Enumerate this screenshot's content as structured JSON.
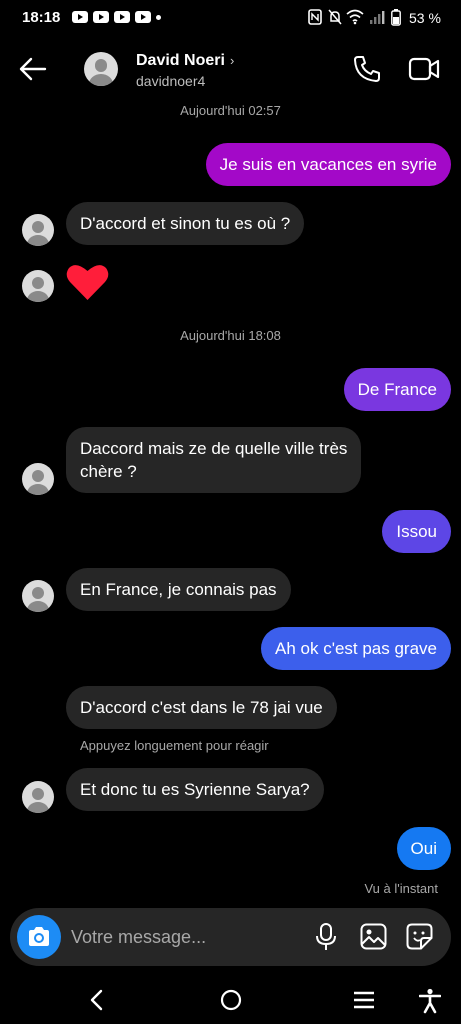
{
  "status_bar": {
    "time": "18:18",
    "battery": "53 %",
    "icons": [
      "youtube-icon",
      "youtube-icon",
      "youtube-icon",
      "youtube-icon",
      "notification-dot",
      "nfc-icon",
      "mute-icon",
      "wifi-icon",
      "signal-icon",
      "battery-icon"
    ]
  },
  "header": {
    "name": "David Noeri",
    "chevron": "›",
    "username": "davidnoer4"
  },
  "timestamps": {
    "first": "Aujourd'hui 02:57",
    "second": "Aujourd'hui 18:08"
  },
  "messages": [
    {
      "from": "me",
      "text": "Je suis en vacances en syrie",
      "color": "#a309c8"
    },
    {
      "from": "them",
      "text": "D'accord et sinon tu es où ?"
    },
    {
      "from": "them",
      "text": "❤️",
      "kind": "heart"
    },
    {
      "from": "me",
      "text": "De France",
      "color": "#7a37e0"
    },
    {
      "from": "them",
      "text": "Daccord mais ze de quelle ville très",
      "text2": "chère ?"
    },
    {
      "from": "me",
      "text": "Issou",
      "color": "#5d46e6"
    },
    {
      "from": "them",
      "text": "En France, je connais pas"
    },
    {
      "from": "me",
      "text": "Ah ok c'est pas grave",
      "color": "#3c5fec"
    },
    {
      "from": "them",
      "text": "D'accord c'est dans le 78 jai vue"
    },
    {
      "from": "them",
      "text": "Et donc tu es Syrienne Sarya?"
    },
    {
      "from": "me",
      "text": "Oui",
      "color": "#1579f2"
    }
  ],
  "notes": {
    "long_press": "Appuyez longuement pour réagir",
    "seen": "Vu à l'instant"
  },
  "composer": {
    "placeholder": "Votre message..."
  },
  "colors": {
    "background": "#000000",
    "incoming_bubble": "#262626",
    "camera_button": "#1d8cf5",
    "heart": "#ff1e3a"
  }
}
